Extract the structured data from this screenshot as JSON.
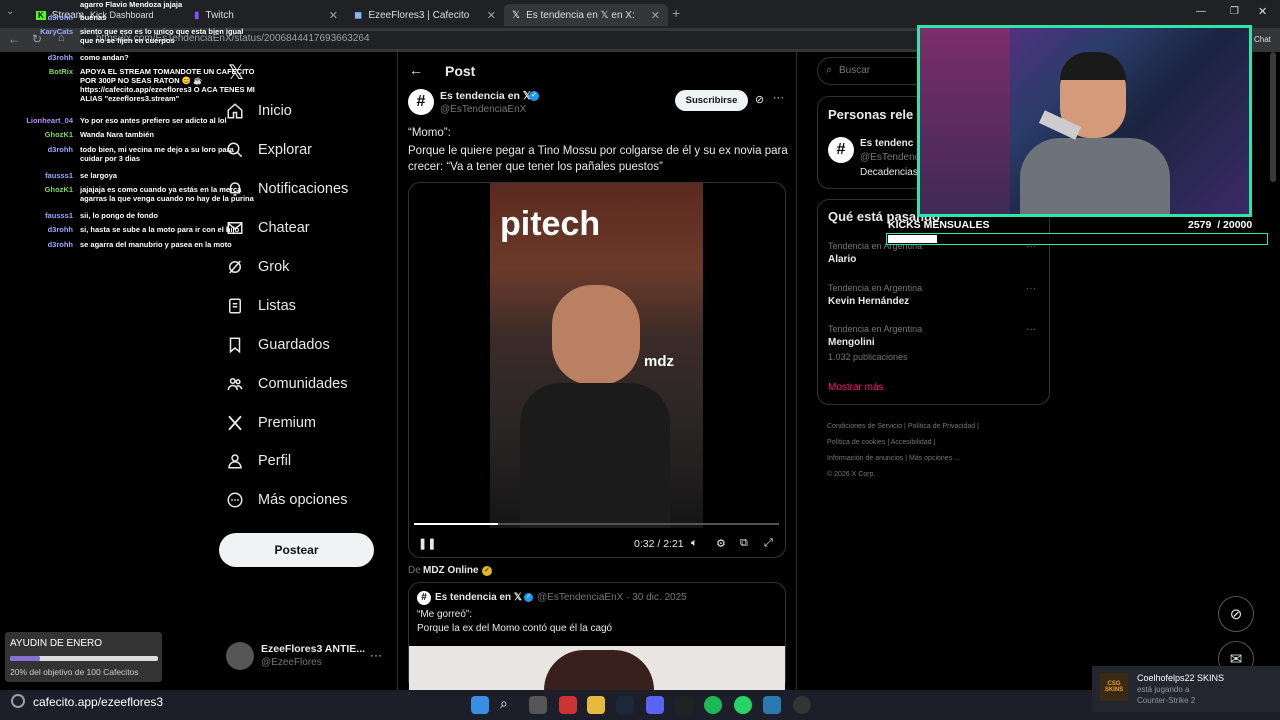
{
  "browser": {
    "tabs": [
      {
        "label": "Stream",
        "sub": "Kick Dashboard"
      },
      {
        "label": "Twitch"
      },
      {
        "label": "EzeeFlores3 | Cafecito"
      },
      {
        "label": "Es tendencia en 𝕏 en X: \"\"Mo"
      }
    ],
    "url": "https://x.com/EsTendenciaEnX/status/2006844417693663264",
    "chat_button": "Chat"
  },
  "chat": [
    {
      "user": "",
      "text": "agarro Flavio Mendoza jajaja"
    },
    {
      "user": "d3rohh",
      "text": "buenas"
    },
    {
      "user": "KaryCats",
      "text": "siento que eso es lo unico que esta bien igual que no se fijen en cuerpos"
    },
    {
      "user": "d3rohh",
      "text": "como andan?"
    },
    {
      "user": "BotRix",
      "text": "APOYA EL STREAM TOMANDOTE UN CAFECITO POR 300P NO SEAS RATON 😊 ☕ https://cafecito.app/ezeeflores3 O ACA TENES MI ALIAS \"ezeeflores3.stream\""
    },
    {
      "user": "Lionheart_04",
      "text": "Yo por eso antes prefiero ser adicto al lol"
    },
    {
      "user": "GhozK1",
      "text": "Wanda Nara también"
    },
    {
      "user": "d3rohh",
      "text": "todo bien, mi vecina me dejo a su loro para cuidar por 3 dias"
    },
    {
      "user": "fausss1",
      "text": "se largoya"
    },
    {
      "user": "GhozK1",
      "text": "jajajaja es como cuando ya estás en la merca agarras la que venga cuando no hay de la purina"
    },
    {
      "user": "fausss1",
      "text": "sii, lo pongo de fondo"
    },
    {
      "user": "d3rohh",
      "text": "si, hasta se sube a la moto para ir con el hijo"
    },
    {
      "user": "d3rohh",
      "text": "se agarra del manubrio y pasea en la moto"
    }
  ],
  "nav": {
    "items": [
      "Inicio",
      "Explorar",
      "Notificaciones",
      "Chatear",
      "Grok",
      "Listas",
      "Guardados",
      "Comunidades",
      "Premium",
      "Perfil",
      "Más opciones"
    ],
    "post_button": "Postear",
    "account_name": "EzeeFlores3 ANTIE...",
    "account_handle": "@EzeeFlores"
  },
  "post": {
    "header": "Post",
    "author": "Es tendencia en 𝕏",
    "handle": "@EsTendenciaEnX",
    "subscribe": "Suscribirse",
    "text_quote": "“Momo”:",
    "text_body": "Porque le quiere pegar a Tino Mossu por colgarse de él y su ex novia para crecer: “Va a tener que tener los pañales puestos”",
    "video_time": "0:32 / 2:21",
    "video_progress": 0.23,
    "video_overlay_brand": "mdz",
    "source_prefix": "De",
    "source_name": "MDZ Online",
    "quoted": {
      "author": "Es tendencia en 𝕏",
      "handle": "@EsTendenciaEnX · 30 dic. 2025",
      "line1": "“Me gorreó”:",
      "line2": "Porque la ex del Momo contó que él la cagó"
    }
  },
  "sidebar": {
    "search_placeholder": "Buscar",
    "people_title": "Personas rele",
    "person_name": "Es tendenc",
    "person_handle": "@EsTendenc",
    "person_desc": "Decadencias",
    "trends_title": "Qué está pasando",
    "trends": [
      {
        "context": "Tendencia en Argentina",
        "name": "Alario",
        "count": ""
      },
      {
        "context": "Tendencia en Argentina",
        "name": "Kevin Hernández",
        "count": ""
      },
      {
        "context": "Tendencia en Argentina",
        "name": "Mengolini",
        "count": "1.032 publicaciones"
      }
    ],
    "show_more": "Mostrar más",
    "footer": [
      "Condiciones de Servicio",
      "Política de Privacidad",
      "Política de cookies",
      "Accesibilidad",
      "Información de anuncios",
      "Más opciones ...",
      "© 2026 X Corp."
    ]
  },
  "stream_overlay": {
    "kicks_label": "KICKS MENSUALES",
    "kicks_value": "2579  / 20000",
    "kicks_progress": 0.129,
    "goal_title": "AYUDIN DE ENERO",
    "goal_progress": 0.2,
    "goal_text": "20% del objetivo de 100 Cafecitos",
    "bottom_url": "cafecito.app/ezeeflores3",
    "steam_name": "Coelhofelps22 SKINS",
    "steam_status": "está jugando a",
    "steam_game": "Counter-Strike 2",
    "steam_badge": "CSG SKINS"
  },
  "colors": {
    "accent": "#1d9bf0",
    "overlay_green": "#2ee6a8",
    "pink_link": "#f91880"
  }
}
